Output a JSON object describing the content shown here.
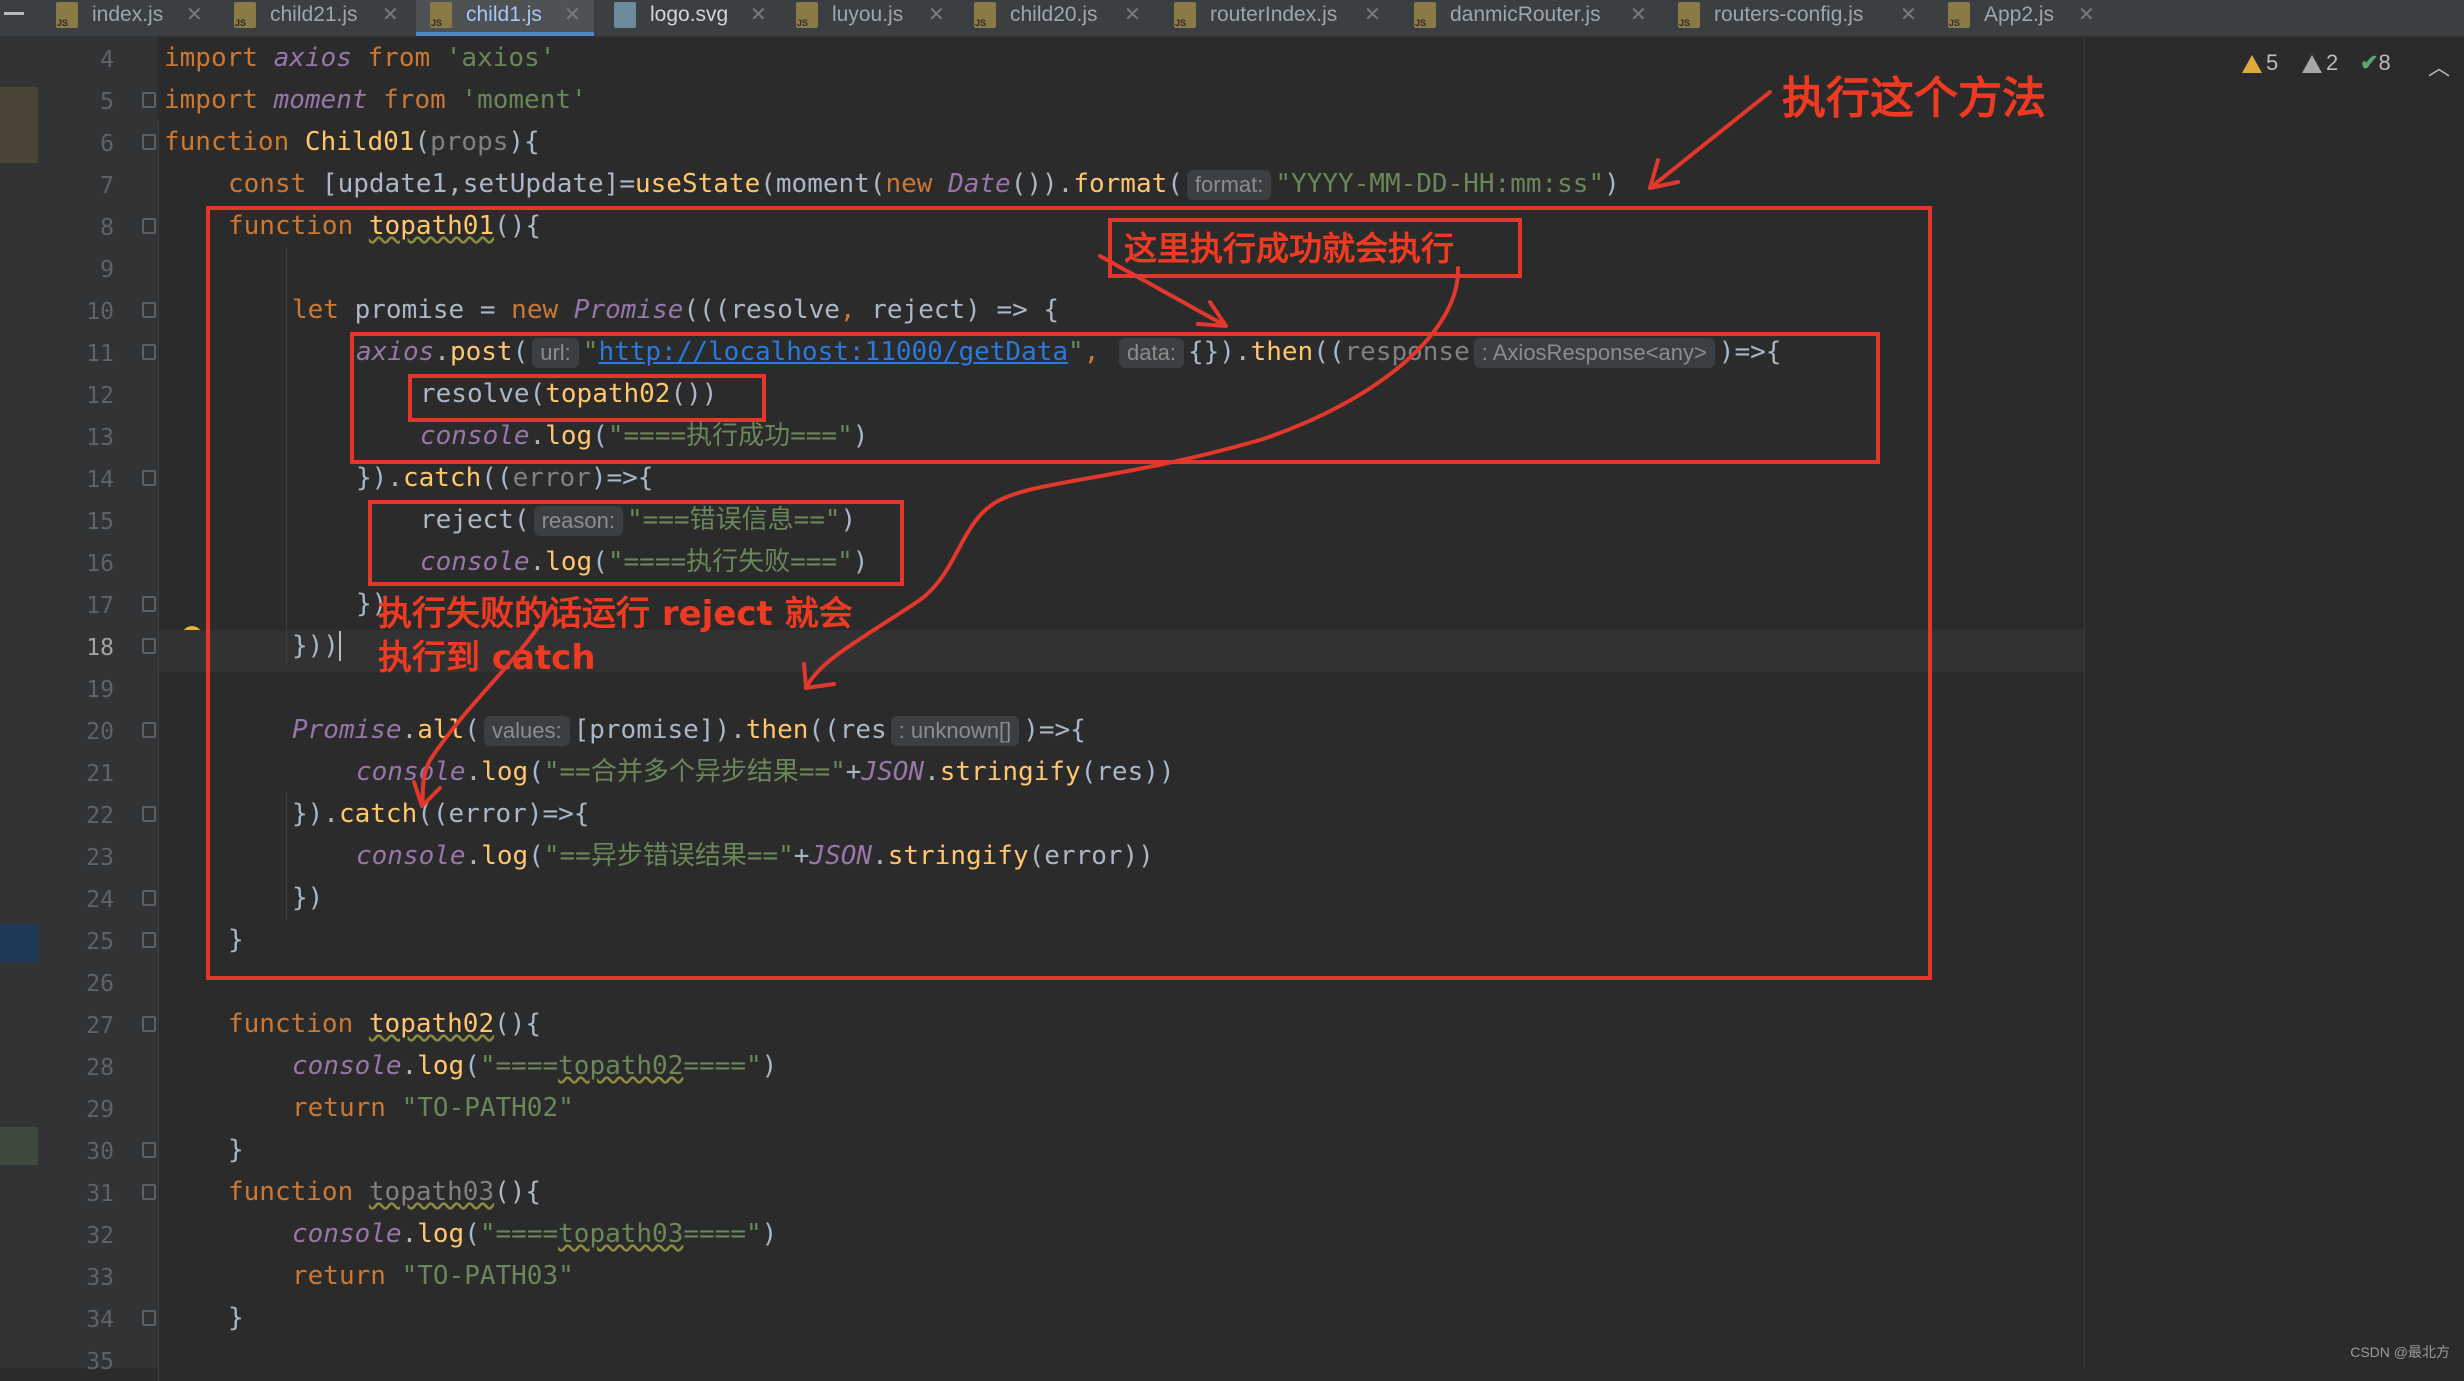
{
  "tabs": [
    {
      "label": "index.js",
      "type": "js"
    },
    {
      "label": "child21.js",
      "type": "js"
    },
    {
      "label": "child1.js",
      "type": "js",
      "active": true
    },
    {
      "label": "logo.svg",
      "type": "svg"
    },
    {
      "label": "luyou.js",
      "type": "js"
    },
    {
      "label": "child20.js",
      "type": "js"
    },
    {
      "label": "routerIndex.js",
      "type": "js"
    },
    {
      "label": "danmicRouter.js",
      "type": "js"
    },
    {
      "label": "routers-config.js",
      "type": "js"
    },
    {
      "label": "App2.js",
      "type": "js"
    }
  ],
  "inspections": {
    "warnings": "5",
    "weak_warnings": "2",
    "ok": "8"
  },
  "current_line": "18",
  "line_numbers": [
    "4",
    "5",
    "6",
    "7",
    "8",
    "9",
    "10",
    "11",
    "12",
    "13",
    "14",
    "15",
    "16",
    "17",
    "18",
    "19",
    "20",
    "21",
    "22",
    "23",
    "24",
    "25",
    "26",
    "27",
    "28",
    "29",
    "30",
    "31",
    "32",
    "33",
    "34",
    "35"
  ],
  "code": {
    "l4_a": "import ",
    "l4_b": "axios",
    "l4_c": " from ",
    "l4_d": "'axios'",
    "l5_a": "import ",
    "l5_b": "moment",
    "l5_c": " from ",
    "l5_d": "'moment'",
    "l6_a": "function ",
    "l6_b": "Child01",
    "l6_c": "(",
    "l6_d": "props",
    "l6_e": "){",
    "l7_a": "const ",
    "l7_b": "[update1,setUpdate]=",
    "l7_c": "useState",
    "l7_d": "(moment(",
    "l7_e": "new ",
    "l7_f": "Date",
    "l7_g": "()).",
    "l7_h": "format",
    "l7_i": "(",
    "l7_hint": "format:",
    "l7_j": "\"YYYY-MM-DD-HH:mm:ss\"",
    "l7_k": ")",
    "l8_a": "function ",
    "l8_b": "topath01",
    "l8_c": "(){",
    "l10_a": "let ",
    "l10_b": "promise = ",
    "l10_c": "new ",
    "l10_d": "Promise",
    "l10_e": "(((resolve",
    "l10_f": ", ",
    "l10_g": "reject) => {",
    "l11_a": "axios",
    "l11_b": ".",
    "l11_c": "post",
    "l11_d": "(",
    "l11_hint1": "url:",
    "l11_e": "\"",
    "l11_url": "http://localhost:11000/getData",
    "l11_f": "\"",
    "l11_g": ", ",
    "l11_hint2": "data:",
    "l11_h": "{}).",
    "l11_i": "then",
    "l11_j": "((",
    "l11_k": "response",
    "l11_hint3": ": AxiosResponse<any>",
    "l11_l": ")=>{",
    "l12_a": "resolve(",
    "l12_b": "topath02",
    "l12_c": "())",
    "l13_a": "console",
    "l13_b": ".",
    "l13_c": "log",
    "l13_d": "(",
    "l13_e": "\"====执行成功===\"",
    "l13_f": ")",
    "l14_a": "}).",
    "l14_b": "catch",
    "l14_c": "((",
    "l14_d": "error",
    "l14_e": ")=>{",
    "l15_a": "reject(",
    "l15_hint": "reason:",
    "l15_b": "\"===错误信息==\"",
    "l15_c": ")",
    "l16_a": "console",
    "l16_b": ".",
    "l16_c": "log",
    "l16_d": "(",
    "l16_e": "\"====执行失败===\"",
    "l16_f": ")",
    "l17_a": "})",
    "l18_a": "}))",
    "l20_a": "Promise",
    "l20_b": ".",
    "l20_c": "all",
    "l20_d": "(",
    "l20_hint": "values:",
    "l20_e": "[promise]).",
    "l20_f": "then",
    "l20_g": "((res",
    "l20_hint2": ": unknown[]",
    "l20_h": ")=>{",
    "l21_a": "console",
    "l21_b": ".",
    "l21_c": "log",
    "l21_d": "(",
    "l21_e": "\"==合并多个异步结果==\"",
    "l21_f": "+",
    "l21_g": "JSON",
    "l21_h": ".",
    "l21_i": "stringify",
    "l21_j": "(res))",
    "l22_a": "}).",
    "l22_b": "catch",
    "l22_c": "((error)=>{",
    "l23_a": "console",
    "l23_b": ".",
    "l23_c": "log",
    "l23_d": "(",
    "l23_e": "\"==异步错误结果==\"",
    "l23_f": "+",
    "l23_g": "JSON",
    "l23_h": ".",
    "l23_i": "stringify",
    "l23_j": "(error))",
    "l24_a": "})",
    "l25_a": "}",
    "l27_a": "function ",
    "l27_b": "topath02",
    "l27_c": "(){",
    "l28_a": "console",
    "l28_b": ".",
    "l28_c": "log",
    "l28_d": "(",
    "l28_e": "\"====",
    "l28_f": "topath02",
    "l28_g": "====\"",
    "l28_h": ")",
    "l29_a": "return ",
    "l29_b": "\"TO-PATH02\"",
    "l30_a": "}",
    "l31_a": "function ",
    "l31_b": "topath03",
    "l31_c": "(){",
    "l32_a": "console",
    "l32_b": ".",
    "l32_c": "log",
    "l32_d": "(",
    "l32_e": "\"====",
    "l32_f": "topath03",
    "l32_g": "====\"",
    "l32_h": ")",
    "l33_a": "return ",
    "l33_b": "\"TO-PATH03\"",
    "l34_a": "}"
  },
  "annotations": {
    "execute_method": "执行这个方法",
    "success_note": "这里执行成功就会执行",
    "reject_note_1": "执行失败的话运行 reject 就会",
    "reject_note_2": "执行到 catch"
  },
  "watermark": "CSDN @最北方",
  "colors": {
    "annotation": "#e2382c",
    "keyword": "#cc7832",
    "function": "#ffc66d",
    "string": "#6a8759",
    "accent_tab": "#4a88c7"
  }
}
